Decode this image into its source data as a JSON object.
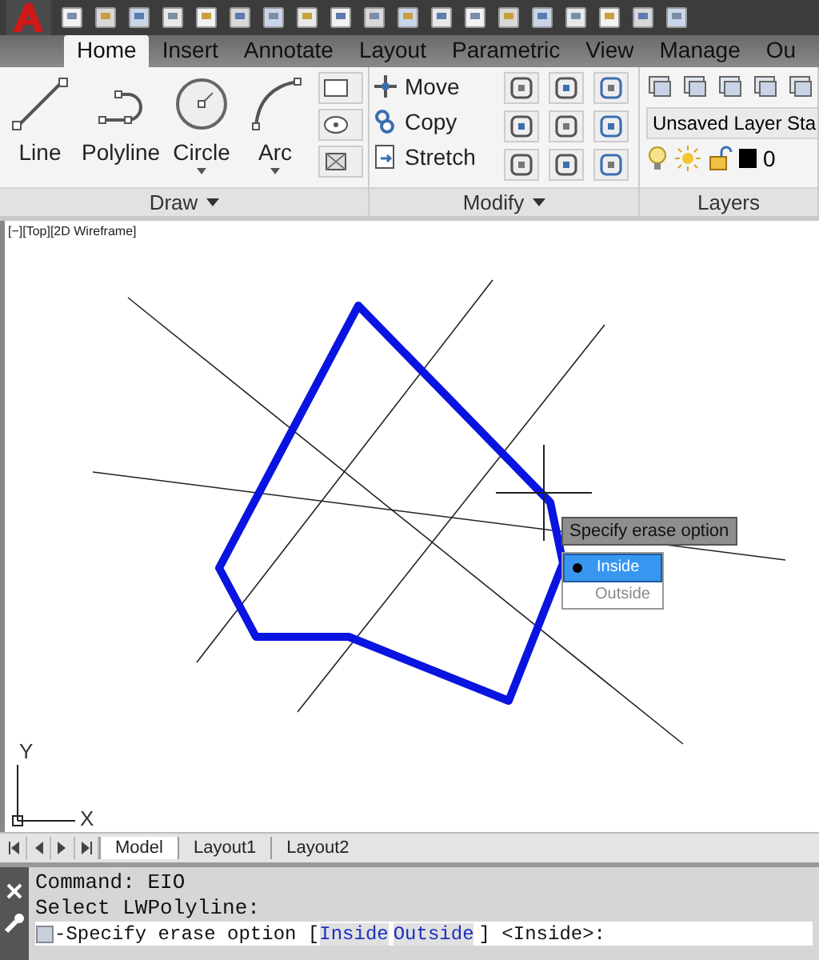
{
  "ribbon_tabs": [
    {
      "label": "Home",
      "selected": true
    },
    {
      "label": "Insert",
      "selected": false
    },
    {
      "label": "Annotate",
      "selected": false
    },
    {
      "label": "Layout",
      "selected": false
    },
    {
      "label": "Parametric",
      "selected": false
    },
    {
      "label": "View",
      "selected": false
    },
    {
      "label": "Manage",
      "selected": false
    },
    {
      "label": "Ou",
      "selected": false
    }
  ],
  "draw_panel": {
    "title": "Draw",
    "tools": [
      {
        "label": "Line",
        "kind": "line"
      },
      {
        "label": "Polyline",
        "kind": "polyline"
      },
      {
        "label": "Circle",
        "kind": "circle"
      },
      {
        "label": "Arc",
        "kind": "arc"
      }
    ]
  },
  "modify_panel": {
    "title": "Modify",
    "tools": [
      {
        "label": "Move",
        "kind": "move"
      },
      {
        "label": "Copy",
        "kind": "copy"
      },
      {
        "label": "Stretch",
        "kind": "stretch"
      }
    ]
  },
  "layers_panel": {
    "title": "Layers",
    "layer_state": "Unsaved Layer Sta",
    "current_layer": "0"
  },
  "viewport": {
    "label": "[−][Top][2D Wireframe]",
    "tooltip": "Specify erase option",
    "options": [
      {
        "label": "Inside",
        "selected": true
      },
      {
        "label": "Outside",
        "selected": false
      }
    ],
    "axis_x": "X",
    "axis_y": "Y"
  },
  "layout_tabs": [
    {
      "label": "Model",
      "selected": true
    },
    {
      "label": "Layout1",
      "selected": false
    },
    {
      "label": "Layout2",
      "selected": false
    }
  ],
  "command_history": [
    "Command: EIO",
    "Select LWPolyline:"
  ],
  "command_prompt": {
    "before": "-Specify erase option [",
    "options": [
      "Inside",
      "Outside"
    ],
    "after": "] <Inside>:"
  }
}
